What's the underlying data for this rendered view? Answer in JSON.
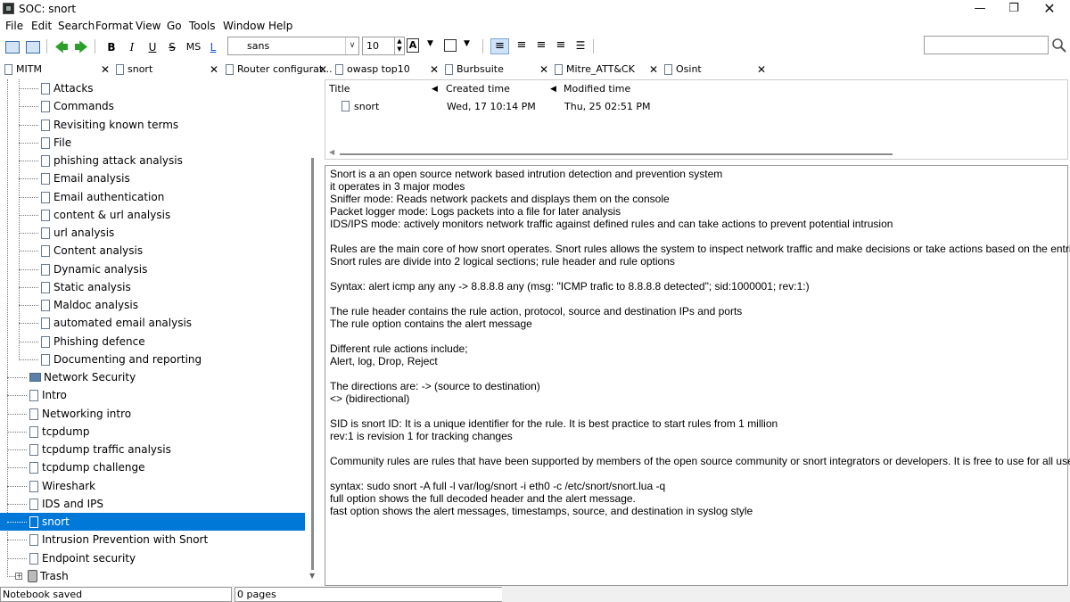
{
  "window": {
    "title": "SOC: snort"
  },
  "menu": [
    "File",
    "Edit",
    "Search",
    "Format",
    "View",
    "Go",
    "Tools",
    "Window",
    "Help"
  ],
  "toolbar": {
    "bold": "B",
    "italic": "I",
    "underline": "U",
    "strike": "S",
    "mono": "MS",
    "link": "L",
    "font_name": "sans",
    "font_size": "10",
    "text_color_glyph": "A"
  },
  "tabs": [
    {
      "label": "MITM"
    },
    {
      "label": "snort"
    },
    {
      "label": "Router configurat..."
    },
    {
      "label": "owasp top10"
    },
    {
      "label": "Burbsuite"
    },
    {
      "label": "Mitre_ATT&CK"
    },
    {
      "label": "Osint"
    }
  ],
  "tree": {
    "items": [
      {
        "label": "Attacks",
        "type": "page",
        "level": 2
      },
      {
        "label": "Commands",
        "type": "page",
        "level": 2
      },
      {
        "label": "Revisiting known terms",
        "type": "page",
        "level": 2
      },
      {
        "label": "File",
        "type": "page",
        "level": 2
      },
      {
        "label": "phishing attack analysis",
        "type": "page",
        "level": 2
      },
      {
        "label": "Email analysis",
        "type": "page",
        "level": 2
      },
      {
        "label": "Email authentication",
        "type": "page",
        "level": 2
      },
      {
        "label": "content & url analysis",
        "type": "page",
        "level": 2
      },
      {
        "label": "url analysis",
        "type": "page",
        "level": 2
      },
      {
        "label": "Content analysis",
        "type": "page",
        "level": 2
      },
      {
        "label": "Dynamic analysis",
        "type": "page",
        "level": 2
      },
      {
        "label": "Static analysis",
        "type": "page",
        "level": 2
      },
      {
        "label": "Maldoc analysis",
        "type": "page",
        "level": 2
      },
      {
        "label": "automated email analysis",
        "type": "page",
        "level": 2
      },
      {
        "label": "Phishing defence",
        "type": "page",
        "level": 2
      },
      {
        "label": "Documenting and reporting",
        "type": "page",
        "level": 2
      },
      {
        "label": "Network Security",
        "type": "folder",
        "level": 1
      },
      {
        "label": "Intro",
        "type": "page",
        "level": 1
      },
      {
        "label": "Networking intro",
        "type": "page",
        "level": 1
      },
      {
        "label": "tcpdump",
        "type": "page",
        "level": 1
      },
      {
        "label": "tcpdump traffic analysis",
        "type": "page",
        "level": 1
      },
      {
        "label": "tcpdump challenge",
        "type": "page",
        "level": 1
      },
      {
        "label": "Wireshark",
        "type": "page",
        "level": 1
      },
      {
        "label": "IDS and IPS",
        "type": "page",
        "level": 1
      },
      {
        "label": "snort",
        "type": "page",
        "level": 1,
        "selected": true
      },
      {
        "label": "Intrusion Prevention with Snort",
        "type": "page",
        "level": 1
      },
      {
        "label": "Endpoint security",
        "type": "page",
        "level": 1
      },
      {
        "label": "Trash",
        "type": "trash",
        "level": 0
      }
    ]
  },
  "list": {
    "columns": [
      "Title",
      "Created time",
      "Modified time"
    ],
    "rows": [
      {
        "title": "snort",
        "created": "Wed, 17 10:14 PM",
        "modified": "Thu, 25 02:51 PM"
      }
    ]
  },
  "editor": {
    "lines": [
      "Snort is a an open source network based intrution detection and prevention system",
      "it operates in 3 major modes",
      "Sniffer mode: Reads network packets and displays them on the console",
      "Packet logger mode: Logs packets into a file for later analysis",
      "IDS/IPS mode: actively monitors network traffic against defined rules and can take actions to prevent potential intrusion",
      "",
      "Rules are the main core of how snort operates. Snort rules allows the system to inspect network traffic and make decisions or take actions based on the entries",
      "Snort rules are divide into 2 logical sections; rule header and rule options",
      "",
      "Syntax: alert icmp any any -> 8.8.8.8 any (msg: \"ICMP trafic to 8.8.8.8 detected\"; sid:1000001; rev:1:)",
      "",
      "The rule header contains the rule action, protocol, source and destination IPs and ports",
      "The rule option contains the alert message",
      "",
      "Different rule actions include;",
      "Alert, log, Drop, Reject",
      "",
      "The directions are: -> (source to destination)",
      "<> (bidirectional)",
      "",
      "SID is snort ID: It is a unique identifier for the rule. It is best practice to start rules from 1 million",
      "rev:1 is revision 1 for tracking changes",
      "",
      "Community rules are rules that have been supported by members of the open source community or snort integrators or developers. It is free to use for all users.",
      "",
      "syntax: sudo snort -A full -l var/log/snort -i eth0 -c /etc/snort/snort.lua -q",
      "full option shows the full decoded header and the alert message.",
      "fast option shows the alert messages, timestamps, source, and destination in syslog style"
    ]
  },
  "status": {
    "left": "Notebook saved",
    "right": "0 pages"
  },
  "colors": {
    "selection": "#0078d7",
    "accent_arrow": "#2aa02a"
  }
}
